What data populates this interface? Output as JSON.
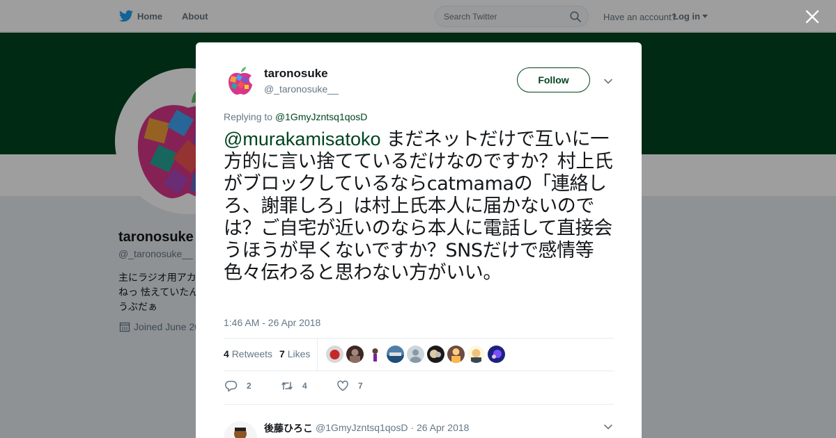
{
  "topbar": {
    "home_label": "Home",
    "about_label": "About",
    "search_placeholder": "Search Twitter",
    "account_prompt": "Have an account?",
    "login_label": "Log in"
  },
  "profile": {
    "name": "taronosuke",
    "handle": "@_taronosuke__",
    "bio": "主にラジオ用アカ\nねっ 怯えていたん\nうぶだぁ",
    "joined": "Joined June 20"
  },
  "tweet": {
    "author_name": "taronosuke",
    "author_handle": "@_taronosuke__",
    "follow_label": "Follow",
    "replying_prefix": "Replying to",
    "replying_to": "@1GmyJzntsq1qosD",
    "mention": "@murakamisatoko",
    "body": " まだネットだけで互いに一方的に言い捨てているだけなのですか？村上氏がブロックしているならcatmamaの「連絡しろ、謝罪しろ」は村上氏本人に届かないのでは？ご自宅が近いのなら本人に電話して直接会うほうが早くないですか？SNSだけで感情等色々伝わると思わない方がいい。",
    "timestamp": "1:46 AM - 26 Apr 2018",
    "retweets_count": "4",
    "retweets_label": "Retweets",
    "likes_count": "7",
    "likes_label": "Likes",
    "reply_action_count": "2",
    "retweet_action_count": "4",
    "like_action_count": "7"
  },
  "reply": {
    "author_name": "後藤ひろこ",
    "author_handle": "@1GmyJzntsq1qosD",
    "date": "26 Apr 2018"
  },
  "colors": {
    "accent": "#00441f",
    "text_secondary": "#657786"
  }
}
